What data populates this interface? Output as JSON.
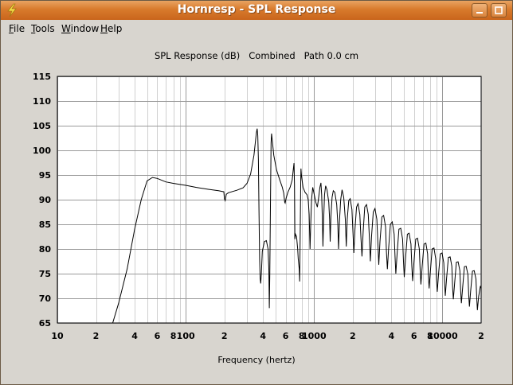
{
  "window": {
    "title": "Hornresp - SPL Response",
    "icon": "lightning-bolt-icon",
    "controls": [
      "minimize-icon",
      "maximize-icon",
      "close-icon"
    ]
  },
  "menu": [
    {
      "label": "File",
      "mnemonic": "F",
      "rest": "ile"
    },
    {
      "label": "Tools",
      "mnemonic": "T",
      "rest": "ools"
    },
    {
      "label": "Window",
      "mnemonic": "W",
      "rest": "indow"
    },
    {
      "label": "Help",
      "mnemonic": "H",
      "rest": "elp"
    }
  ],
  "chart_data": {
    "type": "line",
    "title": "SPL Response (dB)   Combined   Path 0.0 cm",
    "xlabel": "Frequency (hertz)",
    "ylabel": "",
    "xscale": "log",
    "xlim": [
      10,
      20000
    ],
    "ylim": [
      65,
      115
    ],
    "yticks": [
      65,
      70,
      75,
      80,
      85,
      90,
      95,
      100,
      105,
      110,
      115
    ],
    "xtick_labels": [
      {
        "value": 10,
        "label": "10"
      },
      {
        "value": 20,
        "label": "2"
      },
      {
        "value": 40,
        "label": "4"
      },
      {
        "value": 60,
        "label": "6"
      },
      {
        "value": 80,
        "label": "8"
      },
      {
        "value": 100,
        "label": "100"
      },
      {
        "value": 200,
        "label": "2"
      },
      {
        "value": 400,
        "label": "4"
      },
      {
        "value": 600,
        "label": "6"
      },
      {
        "value": 800,
        "label": "8"
      },
      {
        "value": 1000,
        "label": "1000"
      },
      {
        "value": 2000,
        "label": "2"
      },
      {
        "value": 4000,
        "label": "4"
      },
      {
        "value": 6000,
        "label": "6"
      },
      {
        "value": 8000,
        "label": "8"
      },
      {
        "value": 10000,
        "label": "10000"
      },
      {
        "value": 20000,
        "label": "2"
      }
    ],
    "grid": true,
    "line_color": "#000000",
    "series": [
      {
        "name": "",
        "points": [
          [
            27,
            65
          ],
          [
            30,
            69
          ],
          [
            35,
            76
          ],
          [
            40,
            84
          ],
          [
            45,
            90
          ],
          [
            50,
            93.8
          ],
          [
            55,
            94.5
          ],
          [
            60,
            94.3
          ],
          [
            70,
            93.6
          ],
          [
            80,
            93.3
          ],
          [
            100,
            92.9
          ],
          [
            120,
            92.5
          ],
          [
            150,
            92.1
          ],
          [
            180,
            91.8
          ],
          [
            198,
            91.6
          ],
          [
            200,
            90.2
          ],
          [
            203,
            89.8
          ],
          [
            207,
            91.1
          ],
          [
            215,
            91.4
          ],
          [
            250,
            91.9
          ],
          [
            280,
            92.4
          ],
          [
            300,
            93.3
          ],
          [
            320,
            95.2
          ],
          [
            340,
            99
          ],
          [
            350,
            102
          ],
          [
            355,
            103.5
          ],
          [
            360,
            104.4
          ],
          [
            364,
            103
          ],
          [
            368,
            98
          ],
          [
            372,
            88
          ],
          [
            376,
            78
          ],
          [
            380,
            74
          ],
          [
            384,
            73
          ],
          [
            388,
            75
          ],
          [
            395,
            79.5
          ],
          [
            410,
            81.5
          ],
          [
            425,
            81.7
          ],
          [
            438,
            80
          ],
          [
            444,
            76
          ],
          [
            448,
            68
          ],
          [
            452,
            75
          ],
          [
            458,
            92
          ],
          [
            462,
            101.5
          ],
          [
            466,
            103.4
          ],
          [
            472,
            102
          ],
          [
            485,
            99
          ],
          [
            510,
            96
          ],
          [
            540,
            94
          ],
          [
            565,
            92.5
          ],
          [
            580,
            91.3
          ],
          [
            590,
            89.5
          ],
          [
            595,
            89.3
          ],
          [
            605,
            90.3
          ],
          [
            625,
            91.5
          ],
          [
            650,
            92.5
          ],
          [
            675,
            94
          ],
          [
            688,
            96
          ],
          [
            697,
            97.4
          ],
          [
            703,
            93
          ],
          [
            708,
            82
          ],
          [
            716,
            83
          ],
          [
            730,
            82.5
          ],
          [
            745,
            80
          ],
          [
            752,
            78
          ],
          [
            756,
            77.5
          ],
          [
            765,
            76
          ],
          [
            772,
            73.4
          ],
          [
            779,
            82
          ],
          [
            786,
            93
          ],
          [
            790,
            96.3
          ],
          [
            797,
            95
          ],
          [
            820,
            92.5
          ],
          [
            850,
            91.5
          ],
          [
            880,
            91
          ],
          [
            900,
            90
          ],
          [
            915,
            87
          ],
          [
            925,
            82
          ],
          [
            930,
            80
          ],
          [
            942,
            85
          ],
          [
            955,
            90
          ],
          [
            975,
            92.5
          ],
          [
            1000,
            91.2
          ],
          [
            1030,
            89.5
          ],
          [
            1060,
            88.5
          ],
          [
            1080,
            90
          ],
          [
            1110,
            92.5
          ],
          [
            1130,
            93.4
          ],
          [
            1145,
            91
          ],
          [
            1160,
            86
          ],
          [
            1172,
            80.5
          ],
          [
            1186,
            86
          ],
          [
            1205,
            91
          ],
          [
            1230,
            92.8
          ],
          [
            1260,
            92
          ],
          [
            1300,
            89.5
          ],
          [
            1320,
            86
          ],
          [
            1335,
            81.5
          ],
          [
            1352,
            86.5
          ],
          [
            1380,
            90.5
          ],
          [
            1410,
            91.8
          ],
          [
            1450,
            91.5
          ],
          [
            1500,
            89
          ],
          [
            1530,
            85
          ],
          [
            1550,
            80
          ],
          [
            1575,
            85.5
          ],
          [
            1610,
            90
          ],
          [
            1650,
            92
          ],
          [
            1700,
            90.5
          ],
          [
            1750,
            86
          ],
          [
            1780,
            80.5
          ],
          [
            1810,
            86
          ],
          [
            1860,
            89.8
          ],
          [
            1910,
            90.2
          ],
          [
            1970,
            88
          ],
          [
            2010,
            83
          ],
          [
            2040,
            79.2
          ],
          [
            2080,
            84
          ],
          [
            2140,
            88.5
          ],
          [
            2200,
            89.2
          ],
          [
            2270,
            87
          ],
          [
            2320,
            82
          ],
          [
            2360,
            78.5
          ],
          [
            2410,
            83.5
          ],
          [
            2480,
            88.5
          ],
          [
            2560,
            89
          ],
          [
            2640,
            87
          ],
          [
            2700,
            82
          ],
          [
            2740,
            77.5
          ],
          [
            2800,
            82.5
          ],
          [
            2890,
            87.5
          ],
          [
            2980,
            88.2
          ],
          [
            3080,
            86
          ],
          [
            3140,
            81
          ],
          [
            3190,
            76.8
          ],
          [
            3260,
            81.5
          ],
          [
            3370,
            86.5
          ],
          [
            3480,
            86.8
          ],
          [
            3600,
            84.5
          ],
          [
            3660,
            79.5
          ],
          [
            3720,
            75.9
          ],
          [
            3800,
            80
          ],
          [
            3930,
            85
          ],
          [
            4060,
            85.5
          ],
          [
            4200,
            83
          ],
          [
            4270,
            78.5
          ],
          [
            4330,
            75
          ],
          [
            4430,
            79
          ],
          [
            4580,
            84
          ],
          [
            4730,
            84.2
          ],
          [
            4890,
            82
          ],
          [
            4970,
            77.5
          ],
          [
            5040,
            74.3
          ],
          [
            5160,
            78.3
          ],
          [
            5330,
            83
          ],
          [
            5500,
            83.2
          ],
          [
            5680,
            81
          ],
          [
            5770,
            76.5
          ],
          [
            5850,
            73.5
          ],
          [
            5990,
            77.2
          ],
          [
            6190,
            82
          ],
          [
            6390,
            82.2
          ],
          [
            6600,
            80
          ],
          [
            6700,
            75.5
          ],
          [
            6790,
            72.8
          ],
          [
            6950,
            76.5
          ],
          [
            7180,
            81
          ],
          [
            7420,
            81.2
          ],
          [
            7660,
            79
          ],
          [
            7770,
            74.7
          ],
          [
            7870,
            72
          ],
          [
            8050,
            75.5
          ],
          [
            8310,
            80
          ],
          [
            8580,
            80.2
          ],
          [
            8860,
            78
          ],
          [
            8990,
            73.8
          ],
          [
            9100,
            71.3
          ],
          [
            9310,
            74.8
          ],
          [
            9610,
            79
          ],
          [
            9920,
            79.2
          ],
          [
            10240,
            77.2
          ],
          [
            10390,
            73
          ],
          [
            10520,
            70.5
          ],
          [
            10760,
            74
          ],
          [
            11110,
            78.3
          ],
          [
            11470,
            78.4
          ],
          [
            11830,
            76.5
          ],
          [
            12000,
            72.2
          ],
          [
            12150,
            69.8
          ],
          [
            12430,
            73
          ],
          [
            12830,
            77.3
          ],
          [
            13240,
            77.4
          ],
          [
            13660,
            75.6
          ],
          [
            13860,
            71.5
          ],
          [
            14030,
            69
          ],
          [
            14350,
            72.2
          ],
          [
            14820,
            76.4
          ],
          [
            15290,
            76.5
          ],
          [
            15780,
            74.8
          ],
          [
            16010,
            70.7
          ],
          [
            16200,
            68.3
          ],
          [
            16570,
            71.4
          ],
          [
            17110,
            75.5
          ],
          [
            17660,
            75.6
          ],
          [
            18220,
            73.9
          ],
          [
            18480,
            70
          ],
          [
            18700,
            67.6
          ],
          [
            19120,
            70.4
          ],
          [
            19750,
            72.5
          ],
          [
            20000,
            72
          ]
        ]
      }
    ]
  }
}
